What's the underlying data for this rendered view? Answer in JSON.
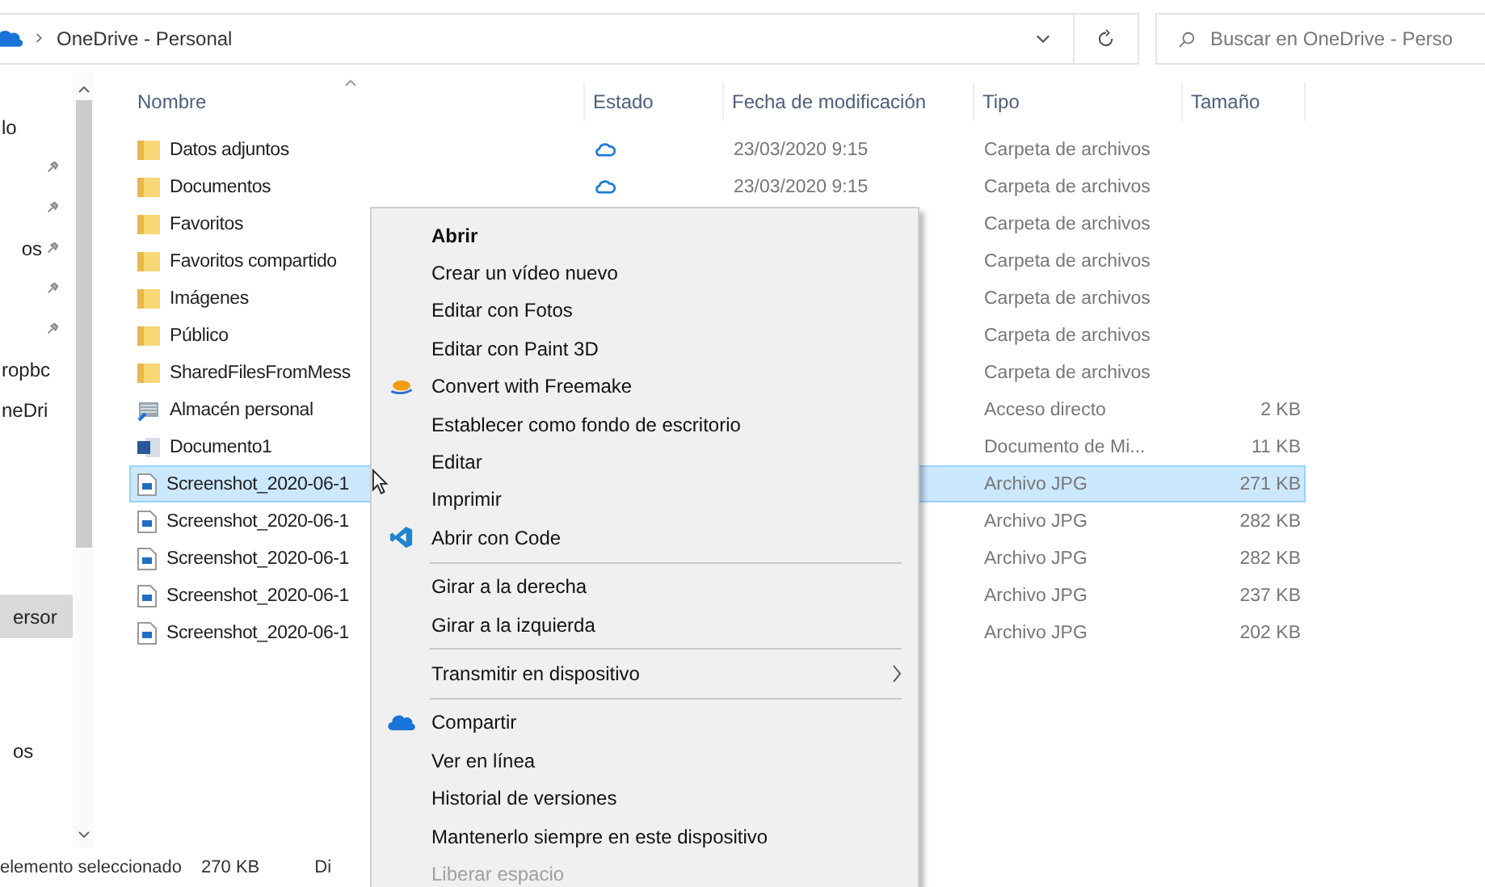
{
  "address_bar": {
    "path": [
      "OneDrive - Personal"
    ]
  },
  "search": {
    "placeholder": "Buscar en OneDrive - Perso"
  },
  "nav_groups": [
    [
      {
        "label": "lo",
        "pinned": false,
        "selected": false
      },
      {
        "pinned": true,
        "selected": false
      },
      {
        "pinned": true,
        "selected": false
      },
      {
        "label": "os",
        "pinned": true,
        "selected": false
      },
      {
        "pinned": true,
        "selected": false
      },
      {
        "pinned": true,
        "selected": false
      },
      {
        "label": "ropbc",
        "pinned": false,
        "selected": false
      },
      {
        "label": "neDri",
        "pinned": false,
        "selected": false
      }
    ],
    [
      {
        "label": "ersor",
        "pinned": false,
        "selected": true
      }
    ],
    [
      {
        "label": "os",
        "pinned": false,
        "selected": false
      }
    ]
  ],
  "columns": [
    "Nombre",
    "Estado",
    "Fecha de modificación",
    "Tipo",
    "Tamaño"
  ],
  "rows": [
    {
      "kind": "folder",
      "name": "Datos adjuntos",
      "cloud_status": true,
      "date": "23/03/2020 9:15",
      "type": "Carpeta de archivos",
      "selected": false
    },
    {
      "kind": "folder",
      "name": "Documentos",
      "cloud_status": true,
      "date": "23/03/2020 9:15",
      "type": "Carpeta de archivos",
      "selected": false
    },
    {
      "kind": "folder",
      "name": "Favoritos",
      "type": "Carpeta de archivos",
      "selected": false
    },
    {
      "kind": "folder",
      "name": "Favoritos compartido",
      "type": "Carpeta de archivos",
      "selected": false
    },
    {
      "kind": "folder",
      "name": "Imágenes",
      "type": "Carpeta de archivos",
      "selected": false
    },
    {
      "kind": "folder",
      "name": "Público",
      "type": "Carpeta de archivos",
      "selected": false
    },
    {
      "kind": "folder",
      "name": "SharedFilesFromMess",
      "type": "Carpeta de archivos",
      "selected": false
    },
    {
      "kind": "shortcut",
      "name": "Almacén personal",
      "type": "Acceso directo",
      "size": "2 KB",
      "selected": false
    },
    {
      "kind": "word",
      "name": "Documento1",
      "type": "Documento de Mi...",
      "size": "11 KB",
      "selected": false
    },
    {
      "kind": "image",
      "name": "Screenshot_2020-06-1",
      "type": "Archivo JPG",
      "size": "271 KB",
      "selected": true
    },
    {
      "kind": "image",
      "name": "Screenshot_2020-06-1",
      "type": "Archivo JPG",
      "size": "282 KB",
      "selected": false
    },
    {
      "kind": "image",
      "name": "Screenshot_2020-06-1",
      "type": "Archivo JPG",
      "size": "282 KB",
      "selected": false
    },
    {
      "kind": "image",
      "name": "Screenshot_2020-06-1",
      "type": "Archivo JPG",
      "size": "237 KB",
      "selected": false
    },
    {
      "kind": "image",
      "name": "Screenshot_2020-06-1",
      "type": "Archivo JPG",
      "size": "202 KB",
      "selected": false
    }
  ],
  "context_menu": [
    {
      "kind": "item",
      "label": "Abrir",
      "bold": true
    },
    {
      "kind": "item",
      "label": "Crear un vídeo nuevo"
    },
    {
      "kind": "item",
      "label": "Editar con Fotos"
    },
    {
      "kind": "item",
      "label": "Editar con Paint 3D"
    },
    {
      "kind": "freemake",
      "label": "Convert with Freemake"
    },
    {
      "kind": "item",
      "label": "Establecer como fondo de escritorio"
    },
    {
      "kind": "item",
      "label": "Editar"
    },
    {
      "kind": "item",
      "label": "Imprimir"
    },
    {
      "kind": "editor",
      "label": "Abrir con Code"
    },
    {
      "kind": "separator"
    },
    {
      "kind": "item",
      "label": "Girar a la derecha"
    },
    {
      "kind": "item",
      "label": "Girar a la izquierda"
    },
    {
      "kind": "separator"
    },
    {
      "kind": "item",
      "label": "Transmitir en dispositivo",
      "submenu": true
    },
    {
      "kind": "separator"
    },
    {
      "kind": "share",
      "label": "Compartir"
    },
    {
      "kind": "item",
      "label": "Ver en línea"
    },
    {
      "kind": "item",
      "label": "Historial de versiones"
    },
    {
      "kind": "item",
      "label": "Mantenerlo siempre en este dispositivo"
    },
    {
      "kind": "item",
      "label": "Liberar espacio",
      "disabled": true
    }
  ],
  "status_bar": {
    "selection": "elemento seleccionado",
    "size": "270 KB",
    "column_3": "Di"
  }
}
